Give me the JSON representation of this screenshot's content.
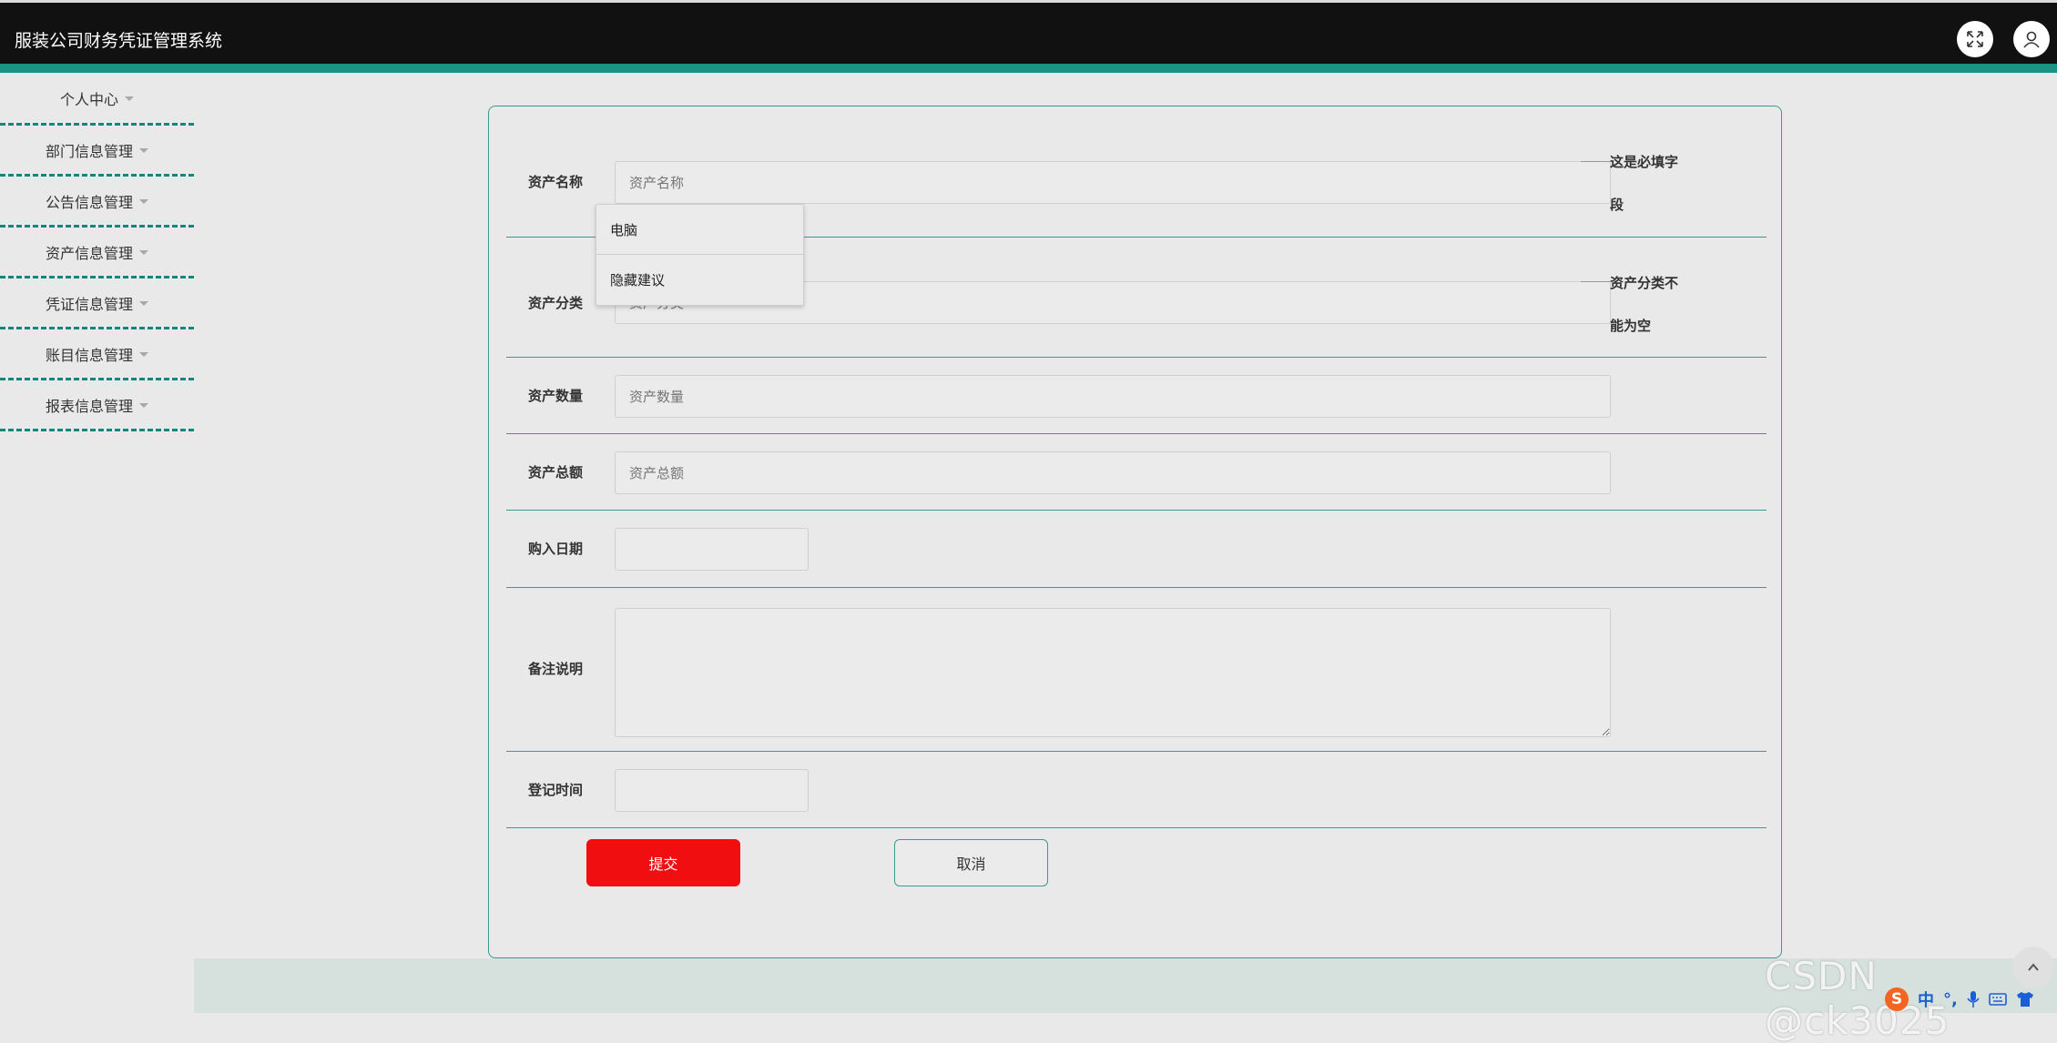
{
  "header": {
    "title": "服装公司财务凭证管理系统",
    "fullscreen_icon": "expand-arrows-icon",
    "user_icon": "user-icon"
  },
  "sidebar": {
    "items": [
      {
        "label": "个人中心"
      },
      {
        "label": "部门信息管理"
      },
      {
        "label": "公告信息管理"
      },
      {
        "label": "资产信息管理"
      },
      {
        "label": "凭证信息管理"
      },
      {
        "label": "账目信息管理"
      },
      {
        "label": "报表信息管理"
      }
    ]
  },
  "form": {
    "asset_name": {
      "label": "资产名称",
      "placeholder": "资产名称",
      "error": [
        "这是必填字",
        "段"
      ]
    },
    "asset_category": {
      "label": "资产分类",
      "placeholder": "资产分类",
      "error": [
        "资产分类不",
        "能为空"
      ]
    },
    "asset_quantity": {
      "label": "资产数量",
      "placeholder": "资产数量"
    },
    "asset_total": {
      "label": "资产总额",
      "placeholder": "资产总额"
    },
    "purchase_date": {
      "label": "购入日期",
      "value": ""
    },
    "remarks": {
      "label": "备注说明",
      "value": ""
    },
    "register_time": {
      "label": "登记时间",
      "value": ""
    },
    "autocomplete": [
      "电脑",
      "隐藏建议"
    ],
    "submit_label": "提交",
    "cancel_label": "取消"
  },
  "watermark": "CSDN @ck3025",
  "ime": {
    "mode": "中"
  },
  "colors": {
    "accent": "#1a9385",
    "submit": "#f00e10",
    "topbar": "#111111"
  }
}
